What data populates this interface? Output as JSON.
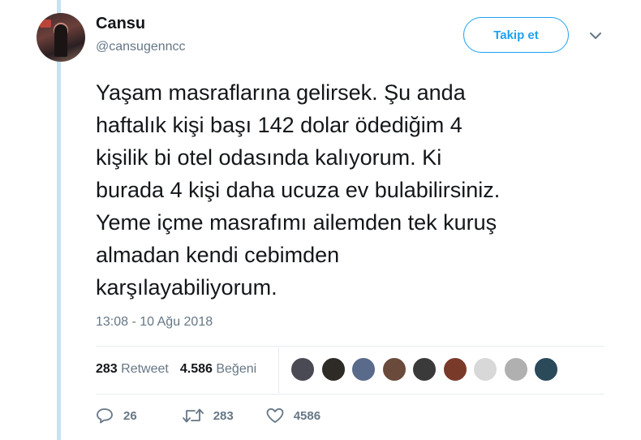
{
  "user": {
    "name": "Cansu",
    "handle": "@cansugenncc"
  },
  "follow_button": {
    "label": "Takip et"
  },
  "tweet": {
    "text": "Yaşam masraflarına gelirsek. Şu anda\nhaftalık kişi başı 142 dolar ödediğim 4\nkişilik bi otel odasında kalıyorum. Ki\nburada 4 kişi daha ucuza ev bulabilirsiniz.\nYeme içme masrafımı ailemden tek kuruş\nalmadan kendi cebimden\nkarşılayabiliyorum.",
    "timestamp": "13:08 - 10 Ağu 2018"
  },
  "stats": {
    "retweets_count": "283",
    "retweets_label": "Retweet",
    "likes_count": "4.586",
    "likes_label": "Beğeni"
  },
  "actions": {
    "reply_count": "26",
    "retweet_count": "283",
    "like_count": "4586"
  },
  "likers": [
    {
      "color": "#4a4a55"
    },
    {
      "color": "#2e2a26"
    },
    {
      "color": "#5a6a8a"
    },
    {
      "color": "#6a4a3a"
    },
    {
      "color": "#3a3a3a"
    },
    {
      "color": "#7a3a2a"
    },
    {
      "color": "#d8d8d8"
    },
    {
      "color": "#b0b0b0"
    },
    {
      "color": "#2a4a5a"
    }
  ],
  "colors": {
    "accent": "#1da1f2",
    "thread_line": "#c4e3f2",
    "muted_text": "#657786"
  }
}
